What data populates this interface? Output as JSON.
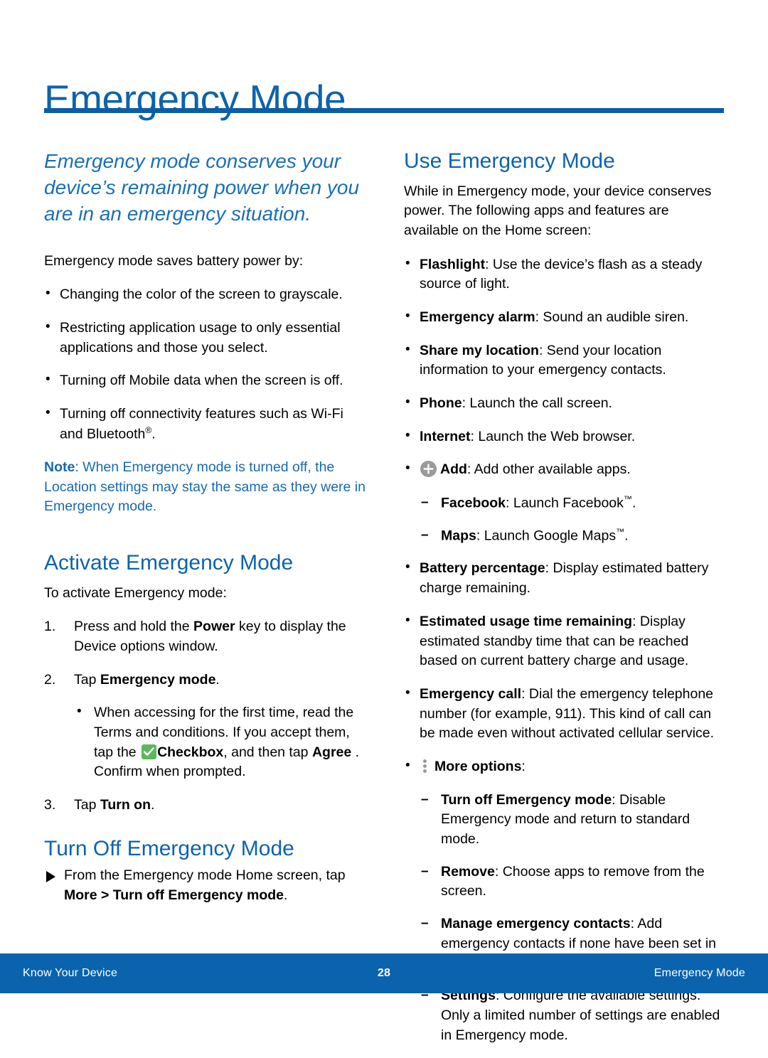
{
  "document": {
    "title": "Emergency Mode"
  },
  "left": {
    "lede": "Emergency mode conserves your device’s remaining power when you are in an emergency situation.",
    "intro": "Emergency mode saves battery power by:",
    "savings_bullets": [
      "Changing the color of the screen to grayscale.",
      "Restricting application usage to only essential applications and those you select.",
      "Turning off Mobile data when the screen is off.",
      "Turning off connectivity features such as Wi-Fi and Bluetooth"
    ],
    "bluetooth_suffix": ".",
    "note": {
      "label": "Note",
      "text": ": When Emergency mode is turned off, the Location settings may stay the same as they were in Emergency mode."
    },
    "activate": {
      "heading": "Activate Emergency Mode",
      "intro": "To activate Emergency mode:",
      "steps": [
        {
          "num": "1.",
          "pre": "Press and hold the ",
          "bold": "Power",
          "post": " key to display the Device options window."
        },
        {
          "num": "2.",
          "pre": "Tap ",
          "bold": "Emergency mode",
          "post": "."
        },
        {
          "num": "3.",
          "pre": "Tap ",
          "bold": "Turn on",
          "post": "."
        }
      ],
      "substep": {
        "part1": "When accessing for the first time, read the Terms and conditions. If you accept them, tap the ",
        "checkbox_icon": "checkbox-icon",
        "bold1": "Checkbox",
        "part2": ", and then tap ",
        "bold2": "Agree",
        "part3": " . Confirm when prompted."
      }
    },
    "turn_off": {
      "heading": "Turn Off Emergency Mode",
      "item": {
        "pre": "From the Emergency mode Home screen, tap ",
        "bold": "More > Turn off Emergency mode",
        "post": "."
      }
    }
  },
  "right": {
    "heading": "Use Emergency Mode",
    "intro": "While in Emergency mode, your device conserves power. The following apps and features are available on the Home screen:",
    "features": [
      {
        "term": "Flashlight",
        "desc": ": Use the device’s flash as a steady source of light."
      },
      {
        "term": "Emergency alarm",
        "desc": ": Sound an audible siren."
      },
      {
        "term": "Share my location",
        "desc": ": Send your location information to your emergency contacts."
      },
      {
        "term": "Phone",
        "desc": ": Launch the call screen."
      },
      {
        "term": "Internet",
        "desc": ": Launch the Web browser."
      }
    ],
    "add": {
      "icon": "add-icon",
      "term": "Add",
      "desc": ": Add other available apps.",
      "subitems": [
        {
          "term": "Facebook",
          "desc_pre": ": Launch Facebook",
          "tm": "™",
          "desc_post": "."
        },
        {
          "term": "Maps",
          "desc_pre": ": Launch Google Maps",
          "tm": "™",
          "desc_post": "."
        }
      ]
    },
    "features2": [
      {
        "term": "Battery percentage",
        "desc": ": Display estimated battery charge remaining."
      },
      {
        "term": "Estimated usage time remaining",
        "desc": ": Display estimated standby time that can be reached based on current battery charge and usage."
      },
      {
        "term": "Emergency call",
        "desc": ": Dial the emergency telephone number (for example, 911). This kind of call can be made even without activated cellular service."
      }
    ],
    "more_options": {
      "icon": "more-options-icon",
      "term": "More options",
      "desc": ":",
      "subitems": [
        {
          "term": "Turn off Emergency mode",
          "desc": ": Disable Emergency mode and return to standard mode."
        },
        {
          "term": "Remove",
          "desc": ": Choose apps to remove from the screen."
        },
        {
          "term": "Manage emergency contacts",
          "desc": ": Add emergency contacts if none have been set in Safety Assistance."
        },
        {
          "term": "Settings",
          "desc": ": Configure the available settings. Only a limited number of settings are enabled in Emergency mode."
        }
      ]
    }
  },
  "footer": {
    "left": "Know Your Device",
    "page_number": "28",
    "right": "Emergency Mode"
  },
  "colors": {
    "heading_blue": "#0d63ac",
    "rule_blue": "#0b5ea6",
    "note_blue": "#1769b0",
    "footer_blue": "#0b63ad",
    "checkbox_green": "#5cb85c",
    "icon_gray": "#9a9a9a"
  }
}
